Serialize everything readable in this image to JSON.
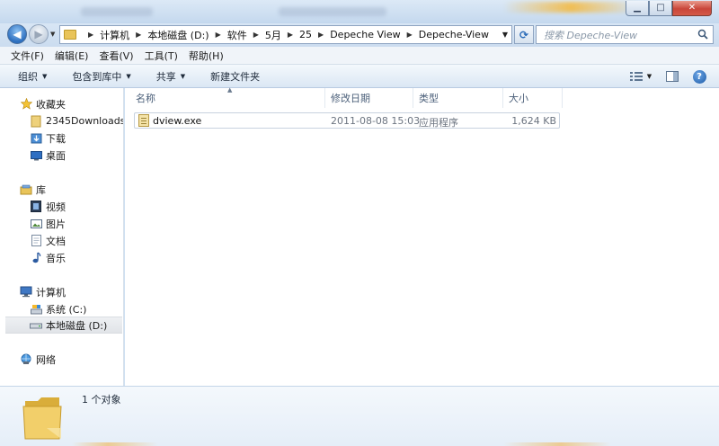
{
  "window": {
    "caption_buttons": {
      "minimize": "▁",
      "maximize": "□",
      "close": "✕"
    }
  },
  "address": {
    "breadcrumbs": [
      "计算机",
      "本地磁盘 (D:)",
      "软件",
      "5月",
      "25",
      "Depeche View",
      "Depeche-View"
    ],
    "search_placeholder": "搜索 Depeche-View"
  },
  "menubar": [
    "文件(F)",
    "编辑(E)",
    "查看(V)",
    "工具(T)",
    "帮助(H)"
  ],
  "commandbar": {
    "organize": "组织",
    "include_in_library": "包含到库中",
    "share": "共享",
    "new_folder": "新建文件夹"
  },
  "navpane": {
    "favorites": {
      "label": "收藏夹",
      "items": [
        "2345Downloads",
        "下载",
        "桌面"
      ]
    },
    "libraries": {
      "label": "库",
      "items": [
        "视频",
        "图片",
        "文档",
        "音乐"
      ]
    },
    "computer": {
      "label": "计算机",
      "items": [
        "系统 (C:)",
        "本地磁盘 (D:)"
      ]
    },
    "network": {
      "label": "网络"
    }
  },
  "columns": {
    "name": "名称",
    "modified": "修改日期",
    "type": "类型",
    "size": "大小"
  },
  "files": [
    {
      "name": "dview.exe",
      "modified": "2011-08-08 15:03",
      "type": "应用程序",
      "size": "1,624 KB"
    }
  ],
  "status": {
    "count": "1 个对象"
  }
}
